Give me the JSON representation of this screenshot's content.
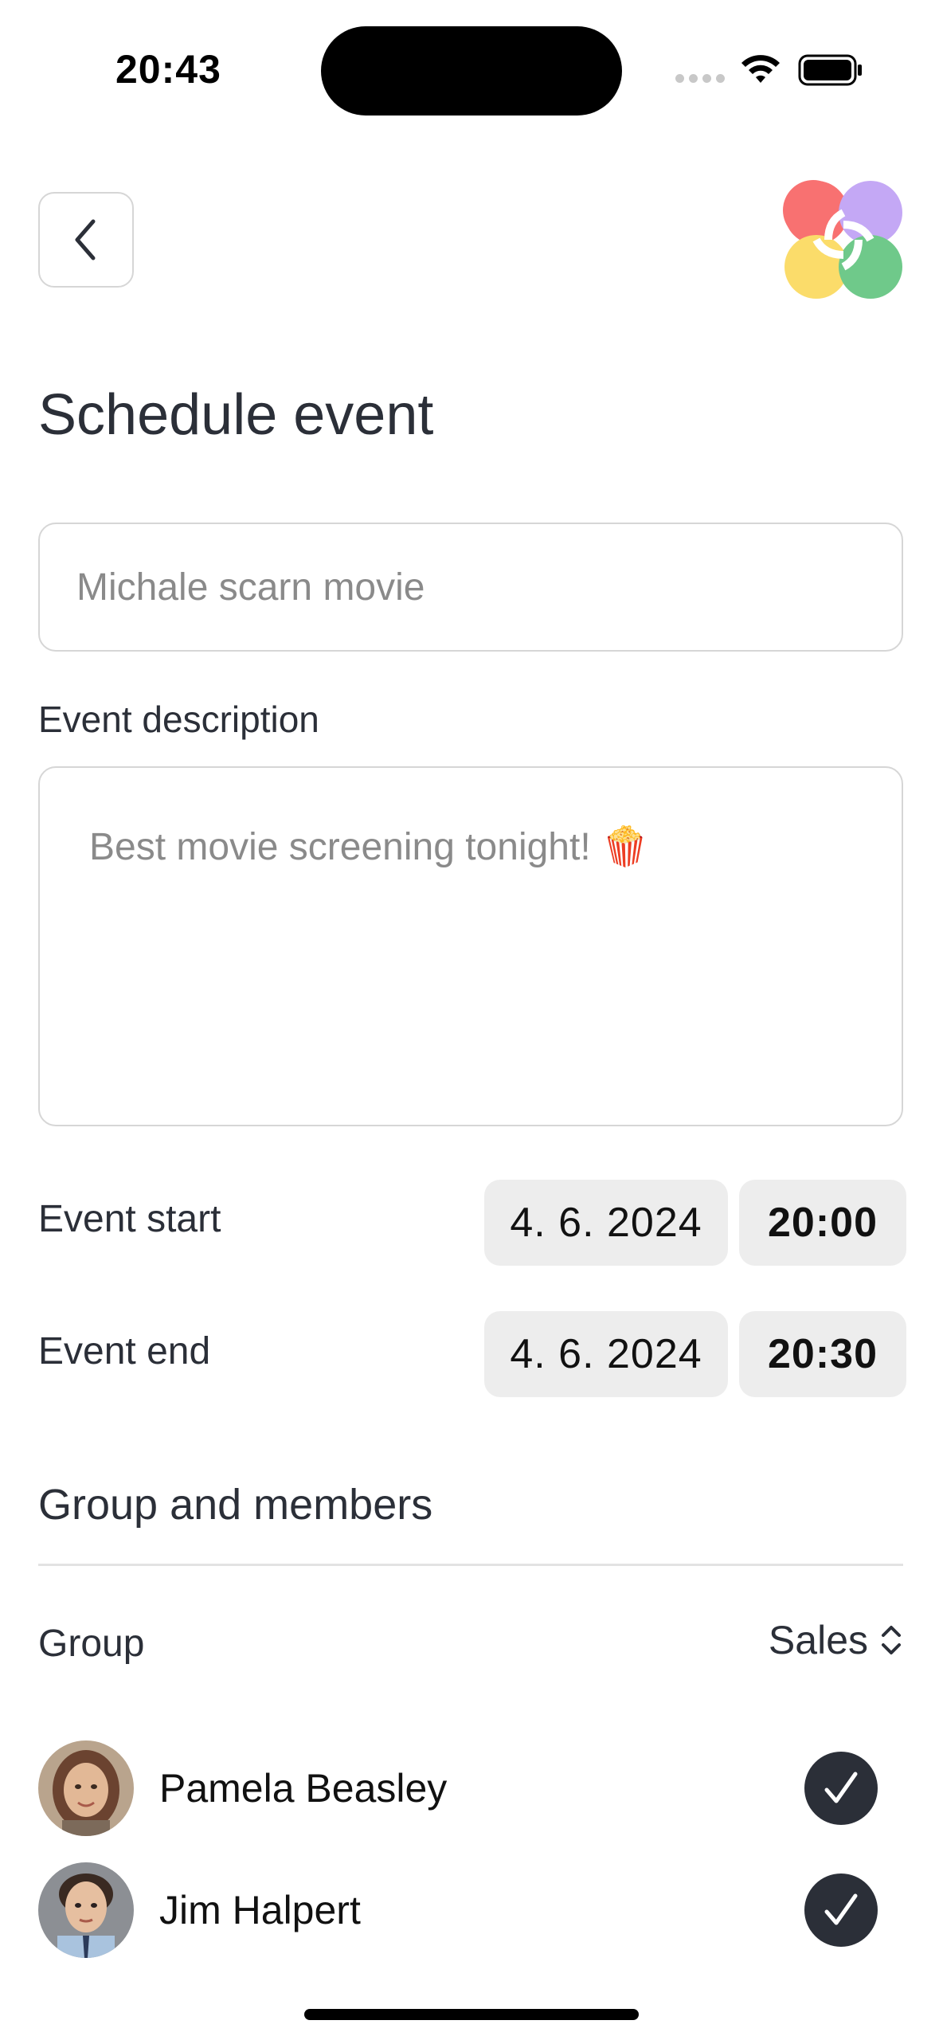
{
  "status_bar": {
    "time": "20:43"
  },
  "header": {
    "back_icon": "chevron-left-icon",
    "logo_icon": "app-logo-icon",
    "title": "Schedule event"
  },
  "form": {
    "name_placeholder": "Michale scarn movie",
    "description_label": "Event description",
    "description_placeholder": "Best movie screening tonight! 🍿",
    "event_start": {
      "label": "Event start",
      "date": "4. 6. 2024",
      "time": "20:00"
    },
    "event_end": {
      "label": "Event end",
      "date": "4. 6. 2024",
      "time": "20:30"
    }
  },
  "group_section": {
    "title": "Group and members",
    "group_label": "Group",
    "group_value": "Sales",
    "members": [
      {
        "name": "Pamela Beasley",
        "selected": true
      },
      {
        "name": "Jim Halpert",
        "selected": true
      }
    ]
  },
  "colors": {
    "text": "#2b2f38",
    "border": "#d6d6d6",
    "pill_bg": "#ededed",
    "logo": [
      "#f87171",
      "#c4a8f5",
      "#fbdc6a",
      "#6fc98a"
    ]
  }
}
